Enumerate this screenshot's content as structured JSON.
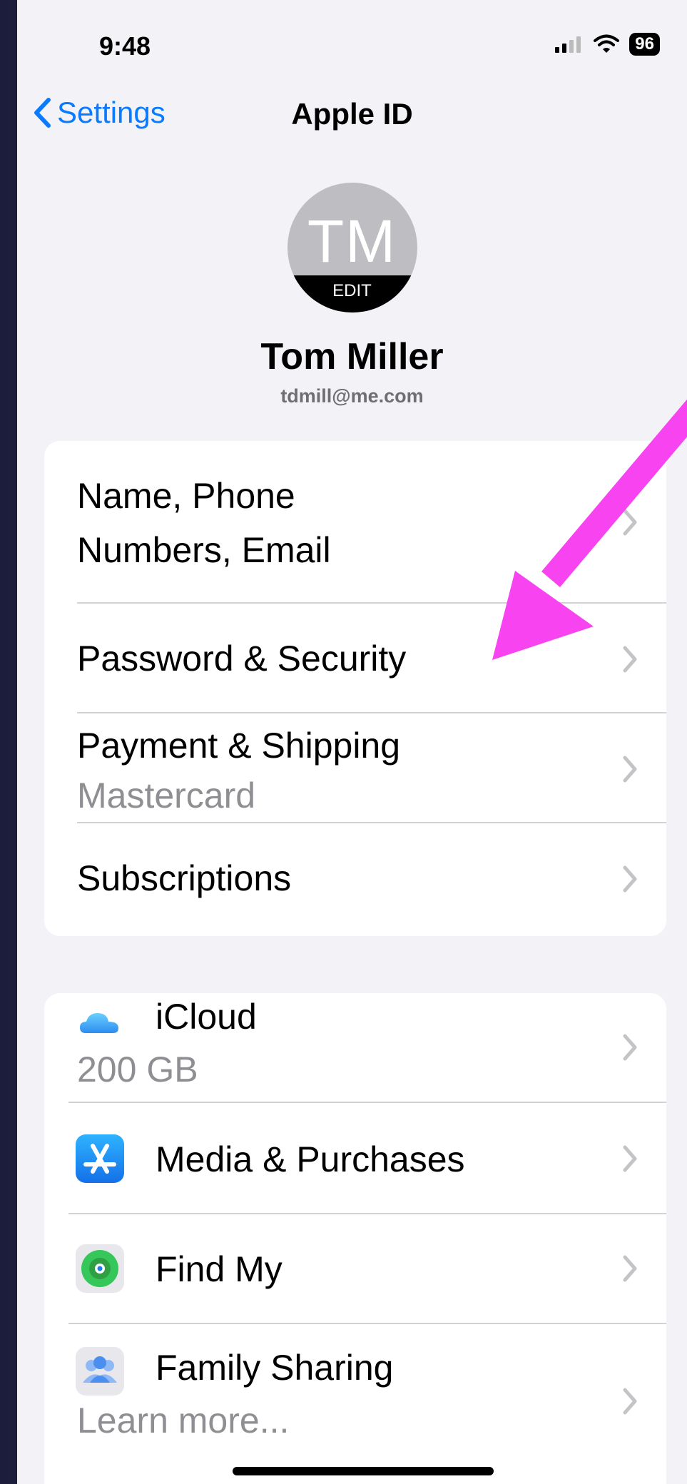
{
  "status_bar": {
    "time": "9:48",
    "battery": "96"
  },
  "nav": {
    "back_label": "Settings",
    "title": "Apple ID"
  },
  "profile": {
    "initials": "TM",
    "edit_label": "EDIT",
    "name": "Tom Miller",
    "email": "tdmill@me.com"
  },
  "account_group": {
    "name_line1": "Name, Phone",
    "name_line2": "Numbers, Email",
    "password": "Password & Security",
    "payment": "Payment & Shipping",
    "payment_sub": "Mastercard",
    "subscriptions": "Subscriptions"
  },
  "services_group": {
    "icloud": "iCloud",
    "icloud_sub": "200 GB",
    "media": "Media & Purchases",
    "findmy": "Find My",
    "family": "Family Sharing",
    "family_sub": "Learn more..."
  },
  "colors": {
    "accent": "#0a7bff",
    "annotation_arrow": "#f844f0"
  }
}
